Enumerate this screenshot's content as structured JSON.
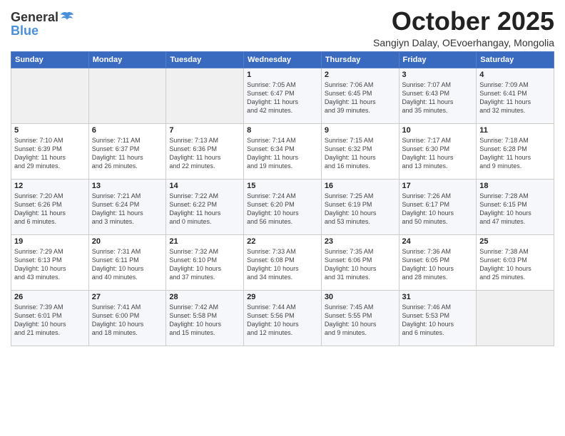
{
  "header": {
    "logo_line1": "General",
    "logo_line2": "Blue",
    "month": "October 2025",
    "location": "Sangiyn Dalay, OEvoerhangay, Mongolia"
  },
  "weekdays": [
    "Sunday",
    "Monday",
    "Tuesday",
    "Wednesday",
    "Thursday",
    "Friday",
    "Saturday"
  ],
  "weeks": [
    [
      {
        "day": "",
        "info": ""
      },
      {
        "day": "",
        "info": ""
      },
      {
        "day": "",
        "info": ""
      },
      {
        "day": "1",
        "info": "Sunrise: 7:05 AM\nSunset: 6:47 PM\nDaylight: 11 hours\nand 42 minutes."
      },
      {
        "day": "2",
        "info": "Sunrise: 7:06 AM\nSunset: 6:45 PM\nDaylight: 11 hours\nand 39 minutes."
      },
      {
        "day": "3",
        "info": "Sunrise: 7:07 AM\nSunset: 6:43 PM\nDaylight: 11 hours\nand 35 minutes."
      },
      {
        "day": "4",
        "info": "Sunrise: 7:09 AM\nSunset: 6:41 PM\nDaylight: 11 hours\nand 32 minutes."
      }
    ],
    [
      {
        "day": "5",
        "info": "Sunrise: 7:10 AM\nSunset: 6:39 PM\nDaylight: 11 hours\nand 29 minutes."
      },
      {
        "day": "6",
        "info": "Sunrise: 7:11 AM\nSunset: 6:37 PM\nDaylight: 11 hours\nand 26 minutes."
      },
      {
        "day": "7",
        "info": "Sunrise: 7:13 AM\nSunset: 6:36 PM\nDaylight: 11 hours\nand 22 minutes."
      },
      {
        "day": "8",
        "info": "Sunrise: 7:14 AM\nSunset: 6:34 PM\nDaylight: 11 hours\nand 19 minutes."
      },
      {
        "day": "9",
        "info": "Sunrise: 7:15 AM\nSunset: 6:32 PM\nDaylight: 11 hours\nand 16 minutes."
      },
      {
        "day": "10",
        "info": "Sunrise: 7:17 AM\nSunset: 6:30 PM\nDaylight: 11 hours\nand 13 minutes."
      },
      {
        "day": "11",
        "info": "Sunrise: 7:18 AM\nSunset: 6:28 PM\nDaylight: 11 hours\nand 9 minutes."
      }
    ],
    [
      {
        "day": "12",
        "info": "Sunrise: 7:20 AM\nSunset: 6:26 PM\nDaylight: 11 hours\nand 6 minutes."
      },
      {
        "day": "13",
        "info": "Sunrise: 7:21 AM\nSunset: 6:24 PM\nDaylight: 11 hours\nand 3 minutes."
      },
      {
        "day": "14",
        "info": "Sunrise: 7:22 AM\nSunset: 6:22 PM\nDaylight: 11 hours\nand 0 minutes."
      },
      {
        "day": "15",
        "info": "Sunrise: 7:24 AM\nSunset: 6:20 PM\nDaylight: 10 hours\nand 56 minutes."
      },
      {
        "day": "16",
        "info": "Sunrise: 7:25 AM\nSunset: 6:19 PM\nDaylight: 10 hours\nand 53 minutes."
      },
      {
        "day": "17",
        "info": "Sunrise: 7:26 AM\nSunset: 6:17 PM\nDaylight: 10 hours\nand 50 minutes."
      },
      {
        "day": "18",
        "info": "Sunrise: 7:28 AM\nSunset: 6:15 PM\nDaylight: 10 hours\nand 47 minutes."
      }
    ],
    [
      {
        "day": "19",
        "info": "Sunrise: 7:29 AM\nSunset: 6:13 PM\nDaylight: 10 hours\nand 43 minutes."
      },
      {
        "day": "20",
        "info": "Sunrise: 7:31 AM\nSunset: 6:11 PM\nDaylight: 10 hours\nand 40 minutes."
      },
      {
        "day": "21",
        "info": "Sunrise: 7:32 AM\nSunset: 6:10 PM\nDaylight: 10 hours\nand 37 minutes."
      },
      {
        "day": "22",
        "info": "Sunrise: 7:33 AM\nSunset: 6:08 PM\nDaylight: 10 hours\nand 34 minutes."
      },
      {
        "day": "23",
        "info": "Sunrise: 7:35 AM\nSunset: 6:06 PM\nDaylight: 10 hours\nand 31 minutes."
      },
      {
        "day": "24",
        "info": "Sunrise: 7:36 AM\nSunset: 6:05 PM\nDaylight: 10 hours\nand 28 minutes."
      },
      {
        "day": "25",
        "info": "Sunrise: 7:38 AM\nSunset: 6:03 PM\nDaylight: 10 hours\nand 25 minutes."
      }
    ],
    [
      {
        "day": "26",
        "info": "Sunrise: 7:39 AM\nSunset: 6:01 PM\nDaylight: 10 hours\nand 21 minutes."
      },
      {
        "day": "27",
        "info": "Sunrise: 7:41 AM\nSunset: 6:00 PM\nDaylight: 10 hours\nand 18 minutes."
      },
      {
        "day": "28",
        "info": "Sunrise: 7:42 AM\nSunset: 5:58 PM\nDaylight: 10 hours\nand 15 minutes."
      },
      {
        "day": "29",
        "info": "Sunrise: 7:44 AM\nSunset: 5:56 PM\nDaylight: 10 hours\nand 12 minutes."
      },
      {
        "day": "30",
        "info": "Sunrise: 7:45 AM\nSunset: 5:55 PM\nDaylight: 10 hours\nand 9 minutes."
      },
      {
        "day": "31",
        "info": "Sunrise: 7:46 AM\nSunset: 5:53 PM\nDaylight: 10 hours\nand 6 minutes."
      },
      {
        "day": "",
        "info": ""
      }
    ]
  ]
}
